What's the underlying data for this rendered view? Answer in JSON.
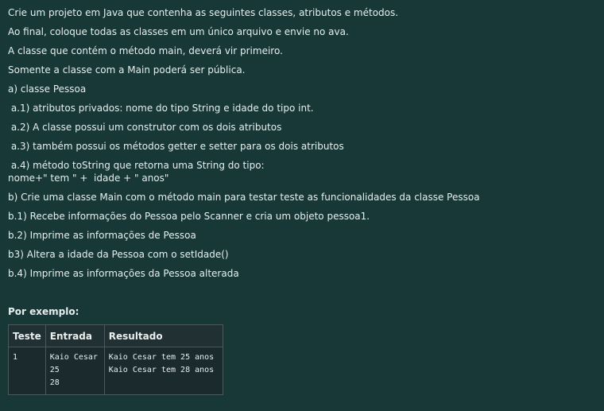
{
  "instructions": {
    "lines": [
      "Crie um projeto em Java que contenha as seguintes classes, atributos e métodos.",
      "Ao final, coloque todas as classes em um único arquivo e envie no ava.",
      "A classe que contém o método main, deverá vir primeiro.",
      "Somente a classe com a Main poderá ser pública.",
      "a) classe Pessoa",
      " a.1) atributos privados: nome do tipo String e idade do tipo int.",
      " a.2) A classe possui um construtor com os dois atributos",
      " a.3) também possui os métodos getter e setter para os dois atributos",
      " a.4) método toString que retorna uma String do tipo:",
      "nome+\" tem \" +  idade + \" anos\"",
      "b) Crie uma classe Main com o método main para testar teste as funcionalidades da classe Pessoa",
      "b.1) Recebe informações do Pessoa pelo Scanner e cria um objeto pessoa1.",
      "b.2) Imprime as informações de Pessoa",
      "b3) Altera a idade da Pessoa com o setIdade()",
      "b.4) Imprime as informações da Pessoa alterada"
    ]
  },
  "example": {
    "label": "Por exemplo:",
    "headers": {
      "teste": "Teste",
      "entrada": "Entrada",
      "resultado": "Resultado"
    },
    "rows": [
      {
        "teste": "1",
        "entrada": [
          "Kaio Cesar",
          "25",
          "28"
        ],
        "resultado": [
          "Kaio Cesar tem 25 anos",
          "Kaio Cesar tem 28 anos"
        ]
      }
    ]
  }
}
